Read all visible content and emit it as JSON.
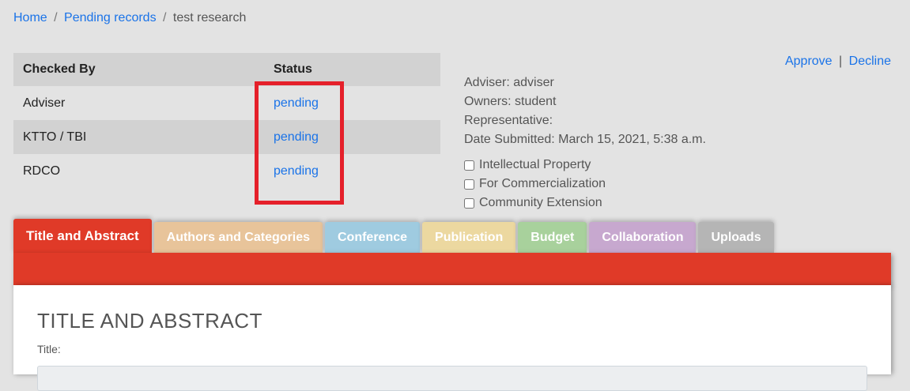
{
  "breadcrumb": {
    "home": "Home",
    "sep1": "/",
    "pending": "Pending records",
    "sep2": "/",
    "current": "test research"
  },
  "checks_table": {
    "headers": [
      "Checked By",
      "Status"
    ],
    "rows": [
      {
        "checker": "Adviser",
        "status": "pending"
      },
      {
        "checker": "KTTO / TBI",
        "status": "pending"
      },
      {
        "checker": "RDCO",
        "status": "pending"
      }
    ]
  },
  "actions": {
    "approve": "Approve",
    "sep": "|",
    "decline": "Decline"
  },
  "info": {
    "adviser": "Adviser: adviser",
    "owners": "Owners: student",
    "representative": "Representative:",
    "date_submitted": "Date Submitted: March 15, 2021, 5:38 a.m."
  },
  "checkboxes": [
    {
      "label": "Intellectual Property",
      "checked": false
    },
    {
      "label": "For Commercialization",
      "checked": false
    },
    {
      "label": "Community Extension",
      "checked": false
    }
  ],
  "tabs": [
    {
      "label": "Title and Abstract",
      "color": "#e03a28",
      "active": true
    },
    {
      "label": "Authors and Categories",
      "color": "#e8c49a",
      "active": false
    },
    {
      "label": "Conference",
      "color": "#9fcbe0",
      "active": false
    },
    {
      "label": "Publication",
      "color": "#ecd8a0",
      "active": false
    },
    {
      "label": "Budget",
      "color": "#a8d19c",
      "active": false
    },
    {
      "label": "Collaboration",
      "color": "#c7a8cf",
      "active": false
    },
    {
      "label": "Uploads",
      "color": "#b5b5b5",
      "active": false
    }
  ],
  "panel": {
    "heading": "TITLE AND ABSTRACT",
    "title_label": "Title:"
  },
  "colors": {
    "highlight_border": "#e5202a",
    "link": "#1a73e8",
    "active_tab": "#e03a28"
  }
}
